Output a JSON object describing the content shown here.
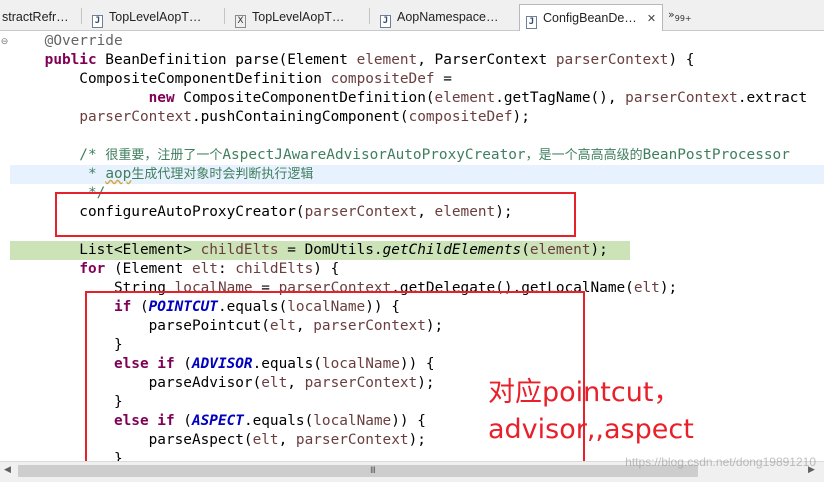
{
  "tabs": [
    {
      "label": "stractRefr…",
      "icon": "java-file-icon",
      "active": false
    },
    {
      "label": "TopLevelAopT…",
      "icon": "java-file-icon",
      "active": false
    },
    {
      "label": "TopLevelAopT…",
      "icon": "xml-file-icon",
      "active": false
    },
    {
      "label": "AopNamespace…",
      "icon": "java-file-icon",
      "active": false
    },
    {
      "label": "ConfigBeanDe…",
      "icon": "java-file-icon",
      "active": true
    }
  ],
  "tab_close": "✕",
  "tab_overflow": {
    "symbol": "»",
    "count": "99+"
  },
  "code": {
    "l1": "@Override",
    "l2a": "public",
    "l2b": " BeanDefinition parse(Element ",
    "l2c": "element",
    "l2d": ", ParserContext ",
    "l2e": "parserContext",
    "l2f": ") {",
    "l3a": "    CompositeComponentDefinition ",
    "l3b": "compositeDef",
    "l3c": " =",
    "l4a": "            ",
    "l4b": "new",
    "l4c": " CompositeComponentDefinition(",
    "l4d": "element",
    "l4e": ".getTagName(), ",
    "l4f": "parserContext",
    "l4g": ".extract",
    "l5a": "    ",
    "l5b": "parserContext",
    "l5c": ".pushContainingComponent(",
    "l5d": "compositeDef",
    "l5e": ");",
    "l7a": "    /* ",
    "l7b": "很重要，注册了一个",
    "l7c": "AspectJAwareAdvisorAutoProxyCreator",
    "l7d": "，是一个高高高级的",
    "l7e": "BeanPostProcessor",
    "l8a": "     * ",
    "l8b": "aop",
    "l8c": "生成代理对象时会判断执行逻辑",
    "l9": "     */",
    "l10a": "    configureAutoProxyCreator(",
    "l10b": "parserContext",
    "l10c": ", ",
    "l10d": "element",
    "l10e": ");",
    "l12a": "    List<Element> ",
    "l12b": "childElts",
    "l12c": " = DomUtils.",
    "l12d": "getChildElements",
    "l12e": "(",
    "l12f": "element",
    "l12g": ");",
    "l13a": "    ",
    "l13b": "for",
    "l13c": " (Element ",
    "l13d": "elt",
    "l13e": ": ",
    "l13f": "childElts",
    "l13g": ") {",
    "l14a": "        String ",
    "l14b": "localName",
    "l14c": " = ",
    "l14d": "parserContext",
    "l14e": ".getDelegate().getLocalName(",
    "l14f": "elt",
    "l14g": ");",
    "l15a": "        ",
    "l15b": "if",
    "l15c": " (",
    "l15d": "POINTCUT",
    "l15e": ".equals(",
    "l15f": "localName",
    "l15g": ")) {",
    "l16a": "            parsePointcut(",
    "l16b": "elt",
    "l16c": ", ",
    "l16d": "parserContext",
    "l16e": ");",
    "l17": "        }",
    "l18a": "        ",
    "l18b": "else if",
    "l18c": " (",
    "l18d": "ADVISOR",
    "l18e": ".equals(",
    "l18f": "localName",
    "l18g": ")) {",
    "l19a": "            parseAdvisor(",
    "l19b": "elt",
    "l19c": ", ",
    "l19d": "parserContext",
    "l19e": ");",
    "l20": "        }",
    "l21a": "        ",
    "l21b": "else if",
    "l21c": " (",
    "l21d": "ASPECT",
    "l21e": ".equals(",
    "l21f": "localName",
    "l21g": ")) {",
    "l22a": "            parseAspect(",
    "l22b": "elt",
    "l22c": ", ",
    "l22d": "parserContext",
    "l22e": ");",
    "l23": "        }"
  },
  "annotation": {
    "line1": "对应pointcut，",
    "line2": "advisor,,aspect"
  },
  "colors": {
    "keyword": "#7f0055",
    "variable": "#6a3e3e",
    "comment": "#3f7f5f",
    "constant": "#0000c0",
    "highlight": "#cbe3b7",
    "annotation_red": "#e8202a"
  },
  "watermark": "https://blog.csdn.net/dong19891210",
  "scrollbar_grip": "III"
}
